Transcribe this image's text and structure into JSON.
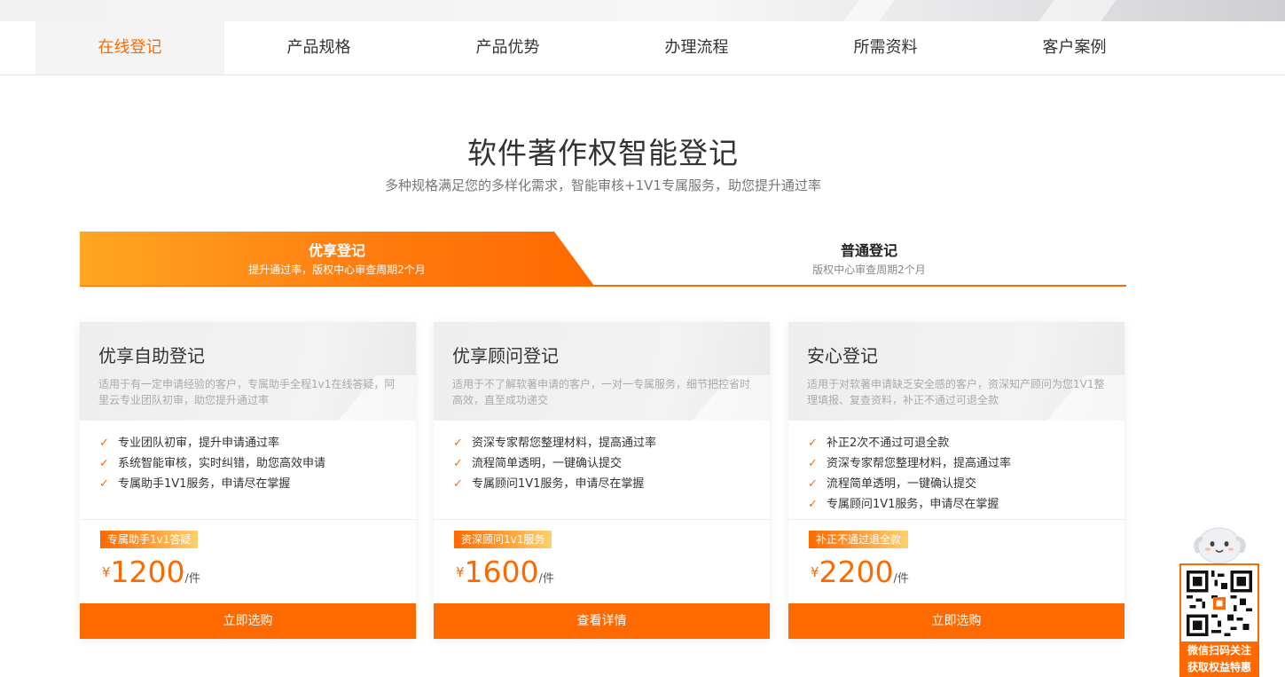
{
  "nav": {
    "items": [
      {
        "label": "在线登记",
        "active": true
      },
      {
        "label": "产品规格",
        "active": false
      },
      {
        "label": "产品优势",
        "active": false
      },
      {
        "label": "办理流程",
        "active": false
      },
      {
        "label": "所需资料",
        "active": false
      },
      {
        "label": "客户案例",
        "active": false
      }
    ]
  },
  "hero": {
    "title": "软件著作权智能登记",
    "subtitle": "多种规格满足您的多样化需求，智能审核+1V1专属服务，助您提升通过率"
  },
  "tabs": {
    "active": {
      "title": "优享登记",
      "subtitle": "提升通过率，版权中心审查周期2个月"
    },
    "normal": {
      "title": "普通登记",
      "subtitle": "版权中心审查周期2个月"
    }
  },
  "cards": [
    {
      "title": "优享自助登记",
      "desc": "适用于有一定申请经验的客户，专属助手全程1v1在线答疑，阿里云专业团队初审，助您提升通过率",
      "features": [
        "专业团队初审，提升申请通过率",
        "系统智能审核，实时纠错，助您高效申请",
        "专属助手1V1服务，申请尽在掌握"
      ],
      "badge": "专属助手1v1答疑",
      "currency": "¥",
      "price": "1200",
      "unit": "/件",
      "cta": "立即选购"
    },
    {
      "title": "优享顾问登记",
      "desc": "适用于不了解软著申请的客户，一对一专属服务，细节把控省时高效，直至成功递交",
      "features": [
        "资深专家帮您整理材料，提高通过率",
        "流程简单透明，一键确认提交",
        "专属顾问1V1服务，申请尽在掌握"
      ],
      "badge": "资深顾问1v1服务",
      "currency": "¥",
      "price": "1600",
      "unit": "/件",
      "cta": "查看详情"
    },
    {
      "title": "安心登记",
      "desc": "适用于对软著申请缺乏安全感的客户，资深知产顾问为您1V1整理填报、复查资料，补正不通过可退全款",
      "features": [
        "补正2次不通过可退全款",
        "资深专家帮您整理材料，提高通过率",
        "流程简单透明，一键确认提交",
        "专属顾问1V1服务，申请尽在掌握"
      ],
      "badge": "补正不通过退全款",
      "currency": "¥",
      "price": "2200",
      "unit": "/件",
      "cta": "立即选购"
    }
  ],
  "float": {
    "line1": "微信扫码关注",
    "line2": "获取权益特惠"
  },
  "colors": {
    "accent": "#ff6a00",
    "badge_end": "#ffd06e",
    "tab_start": "#ffa623"
  }
}
